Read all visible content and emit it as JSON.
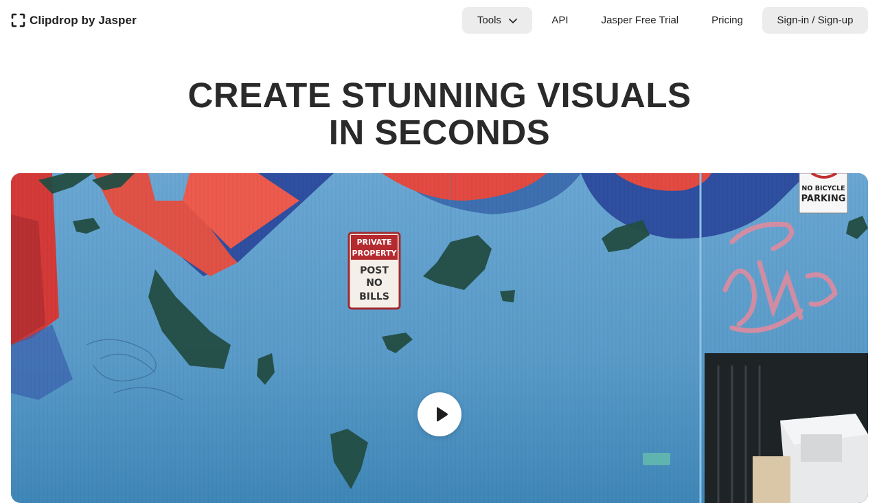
{
  "brand": {
    "name": "Clipdrop by Jasper",
    "logo_icon": "clipdrop-frame-icon"
  },
  "nav": {
    "tools_label": "Tools",
    "api_label": "API",
    "trial_label": "Jasper Free Trial",
    "pricing_label": "Pricing",
    "signin_label": "Sign-in / Sign-up"
  },
  "hero": {
    "title_line1": "CREATE STUNNING VISUALS",
    "title_line2": "IN SECONDS"
  },
  "video": {
    "play_icon": "play-icon",
    "sign_private": {
      "line1": "PRIVATE",
      "line2": "PROPERTY",
      "line3": "POST",
      "line4": "NO",
      "line5": "BILLS"
    },
    "sign_bicycle": {
      "line1": "NO BICYCLE",
      "line2": "PARKING"
    }
  },
  "colors": {
    "nav_pill_bg": "#ececec",
    "wall_blue": "#5d9bc8",
    "mural_red": "#e0483f",
    "mural_navy": "#2f4fa0",
    "graffiti_pink": "#e58a9c"
  }
}
